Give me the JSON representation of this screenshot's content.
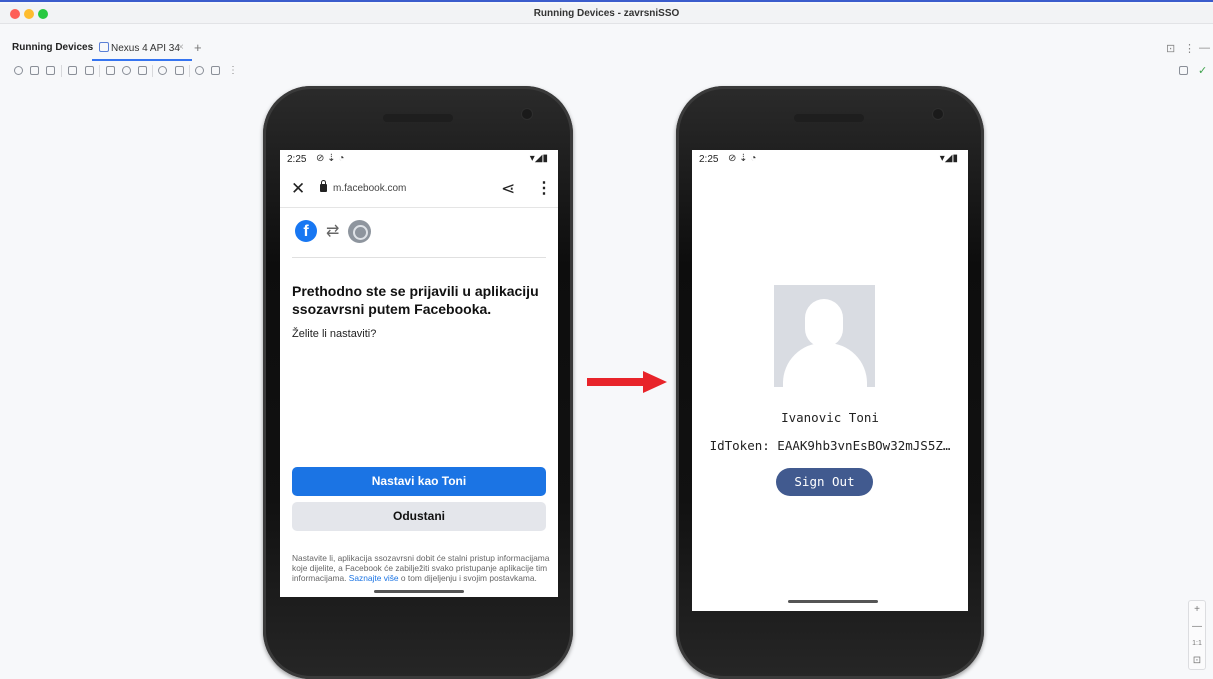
{
  "window": {
    "title": "Running Devices - zavrsniSSO"
  },
  "tabbar": {
    "title": "Running Devices",
    "active_tab": "Nexus 4 API 34",
    "close_glyph": "×",
    "add_glyph": "+"
  },
  "toolbar": {
    "icons": [
      "power-icon",
      "volume-up-icon",
      "volume-down-icon",
      "rotate-left-icon",
      "rotate-right-icon",
      "back-icon",
      "home-icon",
      "overview-icon",
      "camera-icon",
      "screen-record-icon",
      "undo-icon",
      "snapshot-icon",
      "more-icon"
    ]
  },
  "phone_left": {
    "status": {
      "time": "2:25",
      "icons": "⊘ ⇣ ◔",
      "right": "▾◢▮"
    },
    "browser": {
      "url": "m.facebook.com",
      "close": "✕",
      "share": "⋖",
      "menu": "⋮"
    },
    "logos": {
      "fb": "f",
      "swap": "⇄"
    },
    "heading": "Prethodno ste se prijavili u aplikaciju ssozavrsni putem Facebooka.",
    "question": "Želite li nastaviti?",
    "continue_label": "Nastavi kao Toni",
    "cancel_label": "Odustani",
    "legal_text": "Nastavite li, aplikacija ssozavrsni dobit će stalni pristup informacijama koje dijelite, a Facebook će zabilježiti svako pristupanje aplikacije tim informacijama. ",
    "legal_link": "Saznajte više",
    "legal_tail": " o tom dijeljenju i svojim postavkama."
  },
  "phone_right": {
    "status": {
      "time": "2:25",
      "icons": "⊘ ⇣ ◔",
      "right": "▾◢▮"
    },
    "name": "Ivanovic Toni",
    "token": "IdToken: EAAK9hb3vnEsBOw32mJS5Z…",
    "signout_label": "Sign Out"
  },
  "zoom": {
    "plus": "+",
    "minus": "—",
    "ratio": "1:1",
    "fit": "⊡"
  },
  "colors": {
    "accent": "#3574f0",
    "facebook": "#1b74e4",
    "signout": "#415a8f",
    "arrow": "#e8242a"
  }
}
